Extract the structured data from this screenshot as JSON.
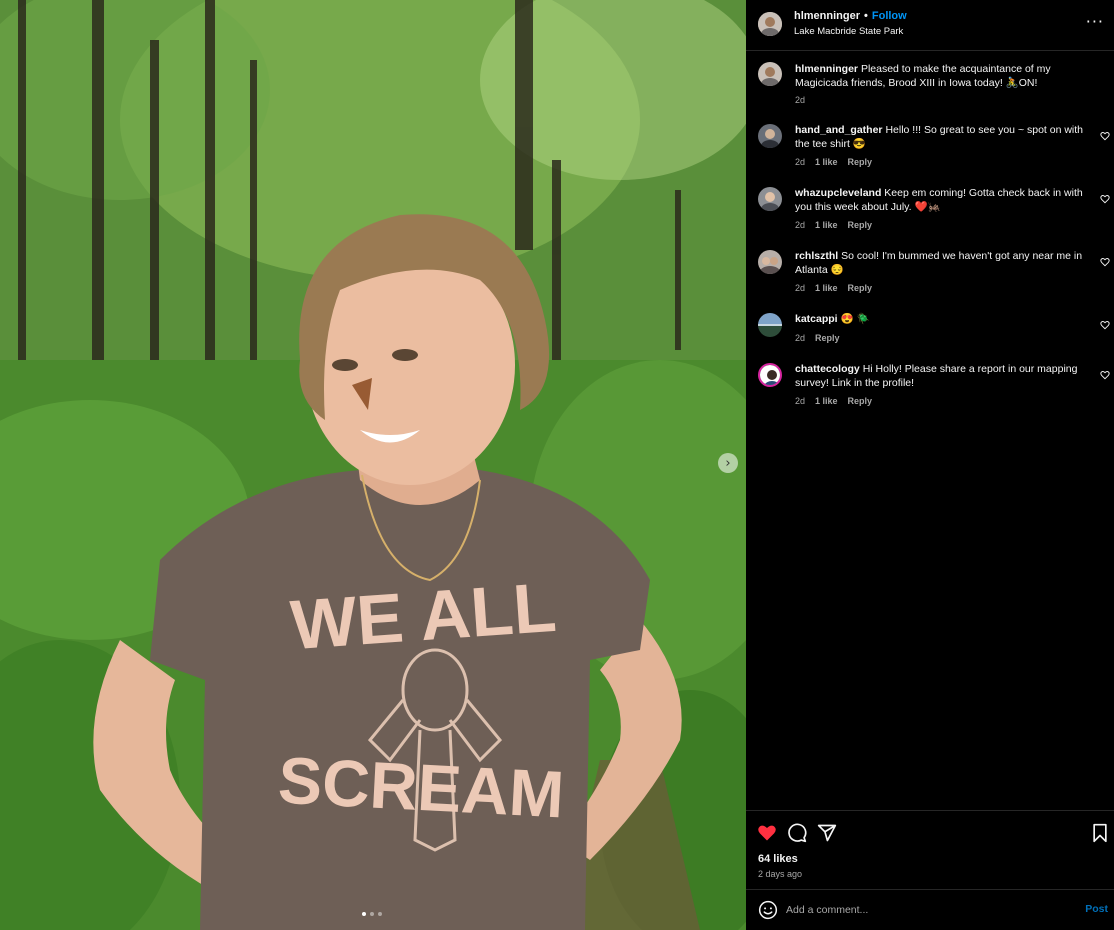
{
  "post": {
    "username": "hlmenninger",
    "follow_label": "Follow",
    "separator": "•",
    "location": "Lake Macbride State Park",
    "more_icon": "more-horizontal-icon"
  },
  "photo": {
    "shirt_text_top": "WE ALL",
    "shirt_text_bottom": "SCREAM",
    "carousel_next_icon": "chevron-right-icon",
    "carousel_total": 3,
    "carousel_active": 1
  },
  "caption": {
    "username": "hlmenninger",
    "text": "Pleased to make the acquaintance of my Magicicada friends, Brood XIII in Iowa today! 🚴ON!",
    "time": "2d"
  },
  "comments": [
    {
      "username": "hand_and_gather",
      "text": "Hello !!! So great to see you ~ spot on with the tee shirt 😎",
      "time": "2d",
      "likes": "1 like",
      "reply": "Reply"
    },
    {
      "username": "whazupcleveland",
      "text": "Keep em coming! Gotta check back in with you this week about July. ❤️🦗",
      "time": "2d",
      "likes": "1 like",
      "reply": "Reply"
    },
    {
      "username": "rchlszthl",
      "text": "So cool! I'm bummed we haven't got any near me in Atlanta 😔",
      "time": "2d",
      "likes": "1 like",
      "reply": "Reply"
    },
    {
      "username": "katcappi",
      "text": "😍 🪲",
      "time": "2d",
      "likes": "",
      "reply": "Reply"
    },
    {
      "username": "chattecology",
      "text": "Hi Holly! Please share a report in our mapping survey! Link in the profile!",
      "time": "2d",
      "likes": "1 like",
      "reply": "Reply"
    }
  ],
  "actions": {
    "likes": "64 likes",
    "time_ago": "2 days ago",
    "liked": true,
    "like_color": "#ff3040"
  },
  "add_comment": {
    "placeholder": "Add a comment...",
    "post_label": "Post"
  },
  "colors": {
    "link": "#0095f6",
    "muted": "#a8a8a8",
    "background": "#000000"
  }
}
